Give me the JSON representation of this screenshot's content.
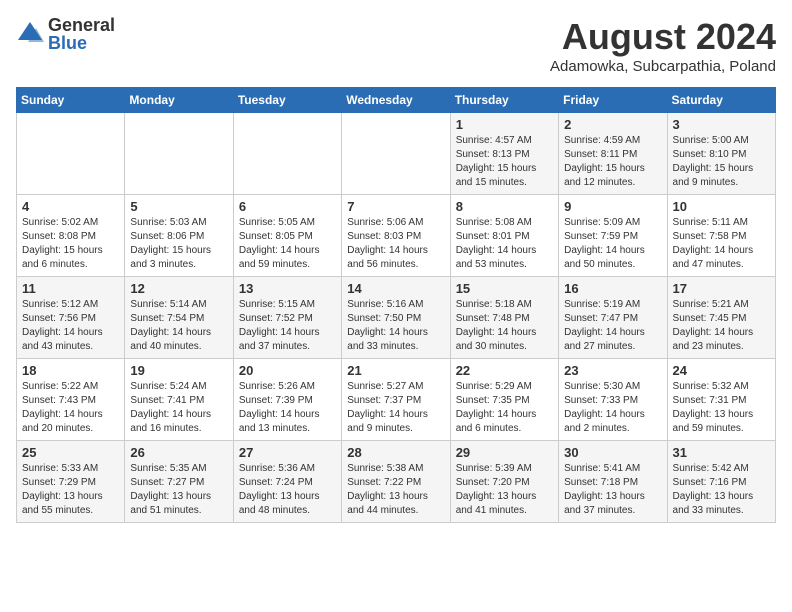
{
  "header": {
    "logo_general": "General",
    "logo_blue": "Blue",
    "month_title": "August 2024",
    "location": "Adamowka, Subcarpathia, Poland"
  },
  "calendar": {
    "weekdays": [
      "Sunday",
      "Monday",
      "Tuesday",
      "Wednesday",
      "Thursday",
      "Friday",
      "Saturday"
    ],
    "weeks": [
      [
        {
          "day": "",
          "info": ""
        },
        {
          "day": "",
          "info": ""
        },
        {
          "day": "",
          "info": ""
        },
        {
          "day": "",
          "info": ""
        },
        {
          "day": "1",
          "info": "Sunrise: 4:57 AM\nSunset: 8:13 PM\nDaylight: 15 hours\nand 15 minutes."
        },
        {
          "day": "2",
          "info": "Sunrise: 4:59 AM\nSunset: 8:11 PM\nDaylight: 15 hours\nand 12 minutes."
        },
        {
          "day": "3",
          "info": "Sunrise: 5:00 AM\nSunset: 8:10 PM\nDaylight: 15 hours\nand 9 minutes."
        }
      ],
      [
        {
          "day": "4",
          "info": "Sunrise: 5:02 AM\nSunset: 8:08 PM\nDaylight: 15 hours\nand 6 minutes."
        },
        {
          "day": "5",
          "info": "Sunrise: 5:03 AM\nSunset: 8:06 PM\nDaylight: 15 hours\nand 3 minutes."
        },
        {
          "day": "6",
          "info": "Sunrise: 5:05 AM\nSunset: 8:05 PM\nDaylight: 14 hours\nand 59 minutes."
        },
        {
          "day": "7",
          "info": "Sunrise: 5:06 AM\nSunset: 8:03 PM\nDaylight: 14 hours\nand 56 minutes."
        },
        {
          "day": "8",
          "info": "Sunrise: 5:08 AM\nSunset: 8:01 PM\nDaylight: 14 hours\nand 53 minutes."
        },
        {
          "day": "9",
          "info": "Sunrise: 5:09 AM\nSunset: 7:59 PM\nDaylight: 14 hours\nand 50 minutes."
        },
        {
          "day": "10",
          "info": "Sunrise: 5:11 AM\nSunset: 7:58 PM\nDaylight: 14 hours\nand 47 minutes."
        }
      ],
      [
        {
          "day": "11",
          "info": "Sunrise: 5:12 AM\nSunset: 7:56 PM\nDaylight: 14 hours\nand 43 minutes."
        },
        {
          "day": "12",
          "info": "Sunrise: 5:14 AM\nSunset: 7:54 PM\nDaylight: 14 hours\nand 40 minutes."
        },
        {
          "day": "13",
          "info": "Sunrise: 5:15 AM\nSunset: 7:52 PM\nDaylight: 14 hours\nand 37 minutes."
        },
        {
          "day": "14",
          "info": "Sunrise: 5:16 AM\nSunset: 7:50 PM\nDaylight: 14 hours\nand 33 minutes."
        },
        {
          "day": "15",
          "info": "Sunrise: 5:18 AM\nSunset: 7:48 PM\nDaylight: 14 hours\nand 30 minutes."
        },
        {
          "day": "16",
          "info": "Sunrise: 5:19 AM\nSunset: 7:47 PM\nDaylight: 14 hours\nand 27 minutes."
        },
        {
          "day": "17",
          "info": "Sunrise: 5:21 AM\nSunset: 7:45 PM\nDaylight: 14 hours\nand 23 minutes."
        }
      ],
      [
        {
          "day": "18",
          "info": "Sunrise: 5:22 AM\nSunset: 7:43 PM\nDaylight: 14 hours\nand 20 minutes."
        },
        {
          "day": "19",
          "info": "Sunrise: 5:24 AM\nSunset: 7:41 PM\nDaylight: 14 hours\nand 16 minutes."
        },
        {
          "day": "20",
          "info": "Sunrise: 5:26 AM\nSunset: 7:39 PM\nDaylight: 14 hours\nand 13 minutes."
        },
        {
          "day": "21",
          "info": "Sunrise: 5:27 AM\nSunset: 7:37 PM\nDaylight: 14 hours\nand 9 minutes."
        },
        {
          "day": "22",
          "info": "Sunrise: 5:29 AM\nSunset: 7:35 PM\nDaylight: 14 hours\nand 6 minutes."
        },
        {
          "day": "23",
          "info": "Sunrise: 5:30 AM\nSunset: 7:33 PM\nDaylight: 14 hours\nand 2 minutes."
        },
        {
          "day": "24",
          "info": "Sunrise: 5:32 AM\nSunset: 7:31 PM\nDaylight: 13 hours\nand 59 minutes."
        }
      ],
      [
        {
          "day": "25",
          "info": "Sunrise: 5:33 AM\nSunset: 7:29 PM\nDaylight: 13 hours\nand 55 minutes."
        },
        {
          "day": "26",
          "info": "Sunrise: 5:35 AM\nSunset: 7:27 PM\nDaylight: 13 hours\nand 51 minutes."
        },
        {
          "day": "27",
          "info": "Sunrise: 5:36 AM\nSunset: 7:24 PM\nDaylight: 13 hours\nand 48 minutes."
        },
        {
          "day": "28",
          "info": "Sunrise: 5:38 AM\nSunset: 7:22 PM\nDaylight: 13 hours\nand 44 minutes."
        },
        {
          "day": "29",
          "info": "Sunrise: 5:39 AM\nSunset: 7:20 PM\nDaylight: 13 hours\nand 41 minutes."
        },
        {
          "day": "30",
          "info": "Sunrise: 5:41 AM\nSunset: 7:18 PM\nDaylight: 13 hours\nand 37 minutes."
        },
        {
          "day": "31",
          "info": "Sunrise: 5:42 AM\nSunset: 7:16 PM\nDaylight: 13 hours\nand 33 minutes."
        }
      ]
    ]
  }
}
